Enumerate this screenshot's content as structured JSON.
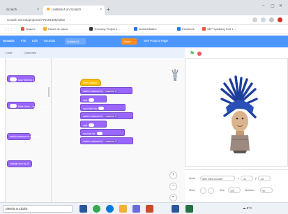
{
  "browser": {
    "tabs": [
      {
        "label": "Scratch",
        "active": false
      },
      {
        "label": "Untitled-4 on Scratch",
        "active": true
      }
    ],
    "new_tab": "+",
    "window_controls": [
      "–",
      "▢",
      "✕"
    ],
    "url": "scratch.mit.edu/projects/776491395/editor",
    "bookmarks": [
      {
        "label": "Shapes",
        "color": "#e8543c"
      },
      {
        "label": "Planet de calcul",
        "color": "#f2b134"
      },
      {
        "label": "Trimming Project 1...",
        "color": "#333333"
      },
      {
        "label": "WorldOfMaths",
        "color": "#1a73e8"
      },
      {
        "label": "Facebook",
        "color": "#1877f2"
      },
      {
        "label": "SEP Speaking Part 1...",
        "color": "#e8543c"
      }
    ]
  },
  "scratch": {
    "menu": {
      "logo": "Scratch",
      "file": "File",
      "edit": "Edit",
      "tutorials": "Tutorials",
      "project_title": "Untitled-4",
      "share": "Share",
      "see_project_page": "See Project Page"
    },
    "editor_tabs": [
      "Code",
      "Costumes",
      "Sounds"
    ],
    "palette_blocks": [
      {
        "label": "say Hello! for 2 seconds"
      },
      {
        "label": "think Hmm... for 2 seconds"
      },
      {
        "label": "switch costume to costume1"
      },
      {
        "label": "change size by 10"
      }
    ],
    "script": {
      "event": "when clicked",
      "blocks": [
        {
          "type": "look",
          "text": "switch costume to",
          "dropdown": "costume 2"
        },
        {
          "type": "look",
          "text": "wait",
          "dropdown": "1 seconds"
        },
        {
          "type": "look",
          "text": "say Hello! for",
          "dropdown": "2 seconds"
        },
        {
          "type": "look",
          "text": "switch costume to",
          "dropdown": "costume 1"
        },
        {
          "type": "look",
          "text": "wait",
          "dropdown": "1 seconds"
        },
        {
          "type": "look",
          "text": "say Bye for",
          "dropdown": "2 seconds"
        },
        {
          "type": "look",
          "text": "switch costume to",
          "dropdown": "costume 3"
        }
      ]
    },
    "zoom": {
      "in": "+",
      "out": "−",
      "reset": "="
    },
    "sprite_info": {
      "sprite_label": "Sprite",
      "sprite_name": "Wee Stink-snooker",
      "x_label": "x",
      "x_value": "-34",
      "y_label": "y",
      "y_value": "-18",
      "show_label": "Show",
      "size_label": "Size",
      "size_value": "100",
      "direction_label": "Direction",
      "direction_value": "90"
    },
    "colors": {
      "menu_blue": "#4c97ff",
      "looks_purple": "#9966ff",
      "events_yellow": "#ffbf00",
      "share_orange": "#ff8c1a"
    }
  },
  "taskbar": {
    "search_placeholder": "pienta a cäuto",
    "apps": [
      {
        "name": "task-view-icon",
        "color": "#2b579a"
      },
      {
        "name": "chrome-icon",
        "color": "#34a853"
      },
      {
        "name": "edge-icon",
        "color": "#0078d7"
      },
      {
        "name": "file-explorer-icon",
        "color": "#f2b134"
      },
      {
        "name": "store-icon",
        "color": "#6b6bd8"
      },
      {
        "name": "powerpoint-icon",
        "color": "#d24726"
      },
      {
        "name": "word-icon",
        "color": "#2b579a"
      },
      {
        "name": "excel-icon",
        "color": "#217346"
      }
    ],
    "temperature": "9°C"
  }
}
